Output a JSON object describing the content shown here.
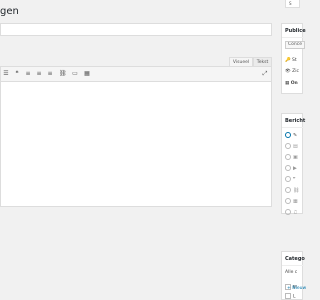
{
  "header": {
    "title": "gen",
    "screen_options": "S"
  },
  "editor": {
    "tabs": [
      "Visueel",
      "Tekst"
    ],
    "toolbar_icons": [
      "list-icon",
      "blockquote-icon",
      "align-left-icon",
      "align-center-icon",
      "align-right-icon",
      "link-icon",
      "more-tag-icon",
      "toolbar-toggle-icon",
      "fullscreen-icon"
    ]
  },
  "publish_box": {
    "title": "Publice",
    "concept_button": "Conce",
    "rows": [
      "St",
      "Zic",
      "On"
    ]
  },
  "format_box": {
    "title": "Bericht",
    "formats": [
      "pin",
      "aside",
      "image",
      "video",
      "quote",
      "link",
      "gallery",
      "audio"
    ]
  },
  "category_box": {
    "title": "Catego",
    "tab": "Alle c",
    "items": [
      "M",
      "L"
    ],
    "add_link": "+ Nieuw"
  }
}
